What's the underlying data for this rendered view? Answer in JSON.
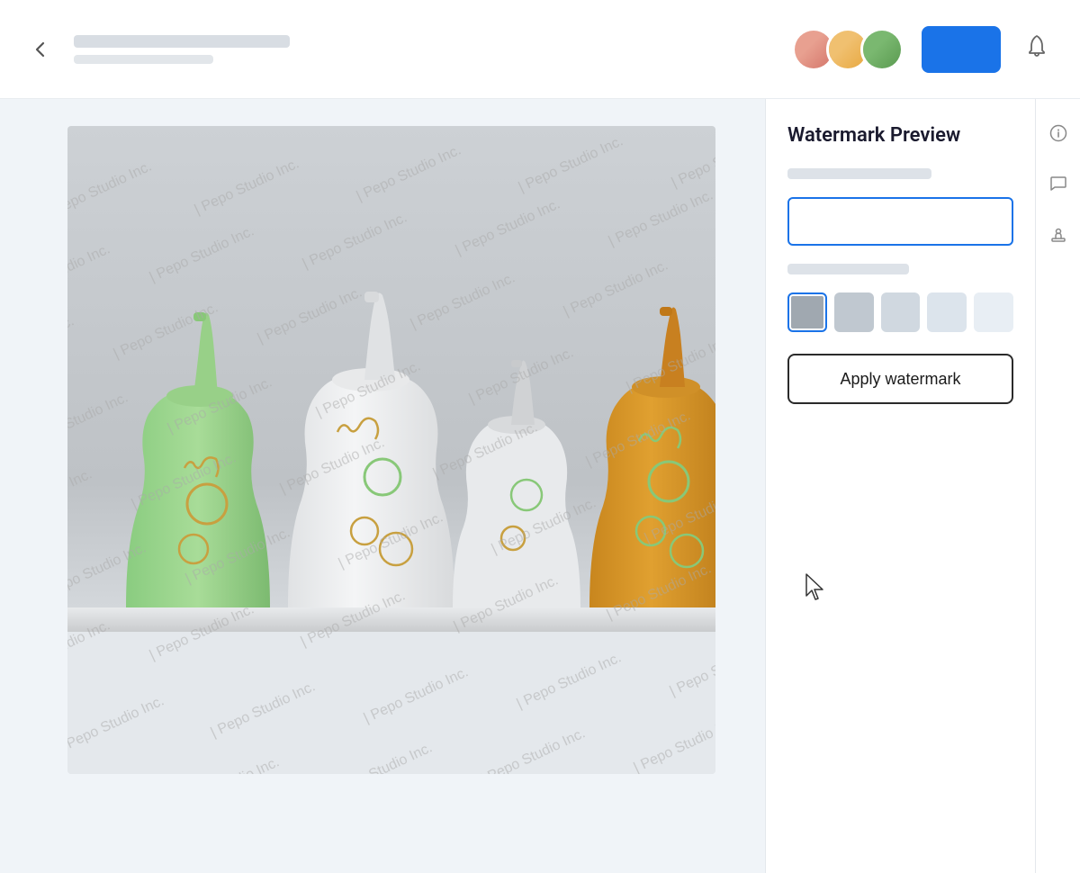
{
  "header": {
    "back_label": "‹",
    "title_placeholder_1": "",
    "title_placeholder_2": "",
    "cta_label": "",
    "notification_icon": "bell-icon",
    "back_icon": "back-arrow-icon"
  },
  "avatars": [
    {
      "id": "avatar-1",
      "initials": "",
      "color": "pink"
    },
    {
      "id": "avatar-2",
      "initials": "",
      "color": "yellow"
    },
    {
      "id": "avatar-3",
      "initials": "",
      "color": "green"
    }
  ],
  "sidebar": {
    "panel_title": "Watermark Preview",
    "input_placeholder": "",
    "apply_button_label": "Apply watermark",
    "swatches": [
      {
        "id": "swatch-1",
        "color": "#a0a8b0",
        "selected": true,
        "label": "gray-dark"
      },
      {
        "id": "swatch-2",
        "color": "#c0c8d0",
        "selected": false,
        "label": "gray-medium"
      },
      {
        "id": "swatch-3",
        "color": "#d0d8e0",
        "selected": false,
        "label": "gray-light"
      },
      {
        "id": "swatch-4",
        "color": "#dce4ec",
        "selected": false,
        "label": "gray-lighter"
      },
      {
        "id": "swatch-5",
        "color": "#e8eef4",
        "selected": false,
        "label": "gray-lightest"
      }
    ]
  },
  "rail_icons": [
    {
      "id": "info-icon",
      "symbol": "ℹ"
    },
    {
      "id": "comment-icon",
      "symbol": "💬"
    },
    {
      "id": "stamp-icon",
      "symbol": "🔏"
    }
  ],
  "watermark_text": "| Pepo Studio Inc.",
  "image": {
    "alt": "Product photo of decorative vases with watermark overlay"
  }
}
